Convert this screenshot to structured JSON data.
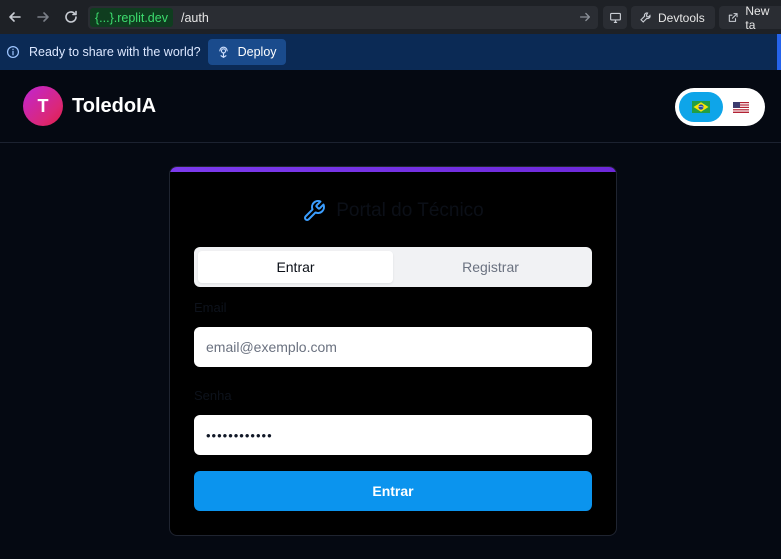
{
  "browser": {
    "domain": "{...}.replit.dev",
    "path": "/auth",
    "buttons": {
      "devtools": "Devtools",
      "new_tab": "New ta"
    }
  },
  "deploy_bar": {
    "message": "Ready to share with the world?",
    "deploy_label": "Deploy"
  },
  "app": {
    "logo_letter": "T",
    "name": "ToledoIA",
    "languages": [
      {
        "code": "pt-BR",
        "flag": "🇧🇷",
        "selected": true
      },
      {
        "code": "en-US",
        "flag": "🇺🇸",
        "selected": false
      }
    ]
  },
  "card": {
    "title": "Portal do Técnico",
    "tabs": [
      {
        "label": "Entrar",
        "active": true
      },
      {
        "label": "Registrar",
        "active": false
      }
    ],
    "email": {
      "label": "Email",
      "placeholder": "email@exemplo.com"
    },
    "password": {
      "label": "Senha",
      "value": "••••••••••••"
    },
    "submit_label": "Entrar"
  },
  "colors": {
    "accent": "#0b94ee",
    "card_top_bar": "#7c3aed",
    "logo_gradient_start": "#c026d3",
    "logo_gradient_end": "#e11d48",
    "title_icon": "#3b9eff"
  }
}
